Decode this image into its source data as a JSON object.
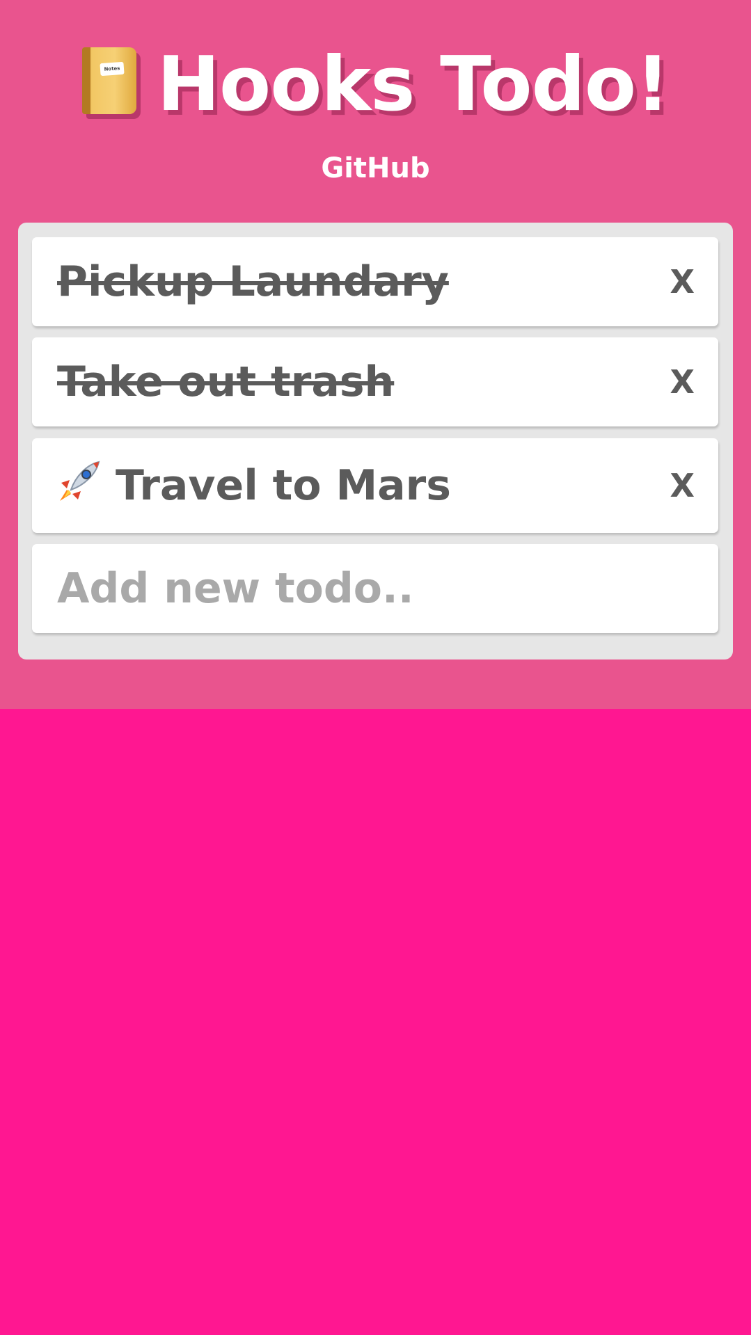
{
  "header": {
    "icon": "notebook-icon",
    "notebook_tag": "Notes",
    "title": "Hooks Todo!",
    "link_label": "GitHub"
  },
  "todos": [
    {
      "text": "Pickup Laundary",
      "completed": true,
      "remove_label": "X"
    },
    {
      "text": "Take out trash",
      "completed": true,
      "remove_label": "X"
    },
    {
      "text": "Travel to Mars",
      "completed": false,
      "icon": "rocket-icon",
      "remove_label": "X"
    }
  ],
  "new_todo": {
    "placeholder": "Add new todo..",
    "value": ""
  },
  "colors": {
    "background": "#ff1791",
    "header_background": "#e9548e",
    "panel": "#e6e6e6",
    "card": "#ffffff",
    "text": "#5b5b5b",
    "placeholder": "#a9a9a9"
  }
}
